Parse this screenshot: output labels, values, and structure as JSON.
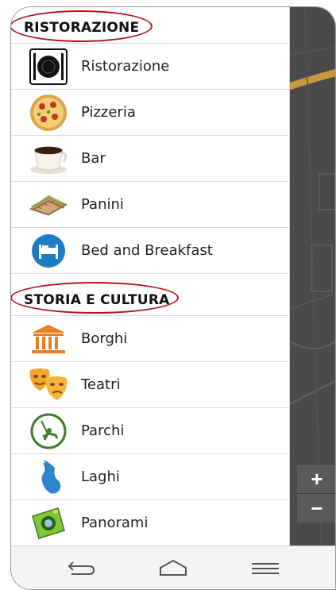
{
  "sections": [
    {
      "title": "RISTORAZIONE",
      "items": [
        {
          "label": "Ristorazione",
          "icon": "plate-cutlery-icon"
        },
        {
          "label": "Pizzeria",
          "icon": "pizza-icon"
        },
        {
          "label": "Bar",
          "icon": "coffee-cup-icon"
        },
        {
          "label": "Panini",
          "icon": "sandwich-icon"
        },
        {
          "label": "Bed and Breakfast",
          "icon": "bed-icon"
        }
      ]
    },
    {
      "title": "STORIA E CULTURA",
      "items": [
        {
          "label": "Borghi",
          "icon": "temple-icon"
        },
        {
          "label": "Teatri",
          "icon": "theater-masks-icon"
        },
        {
          "label": "Parchi",
          "icon": "swing-park-icon"
        },
        {
          "label": "Laghi",
          "icon": "lake-icon"
        },
        {
          "label": "Panorami",
          "icon": "camera-icon"
        }
      ]
    }
  ],
  "map": {
    "zoom_in_label": "+",
    "zoom_out_label": "−"
  },
  "navbar": {
    "back": "back-icon",
    "home": "home-icon",
    "menu": "menu-icon"
  },
  "colors": {
    "highlight_ellipse": "#b8121c",
    "map_background": "#4a4a4a"
  }
}
